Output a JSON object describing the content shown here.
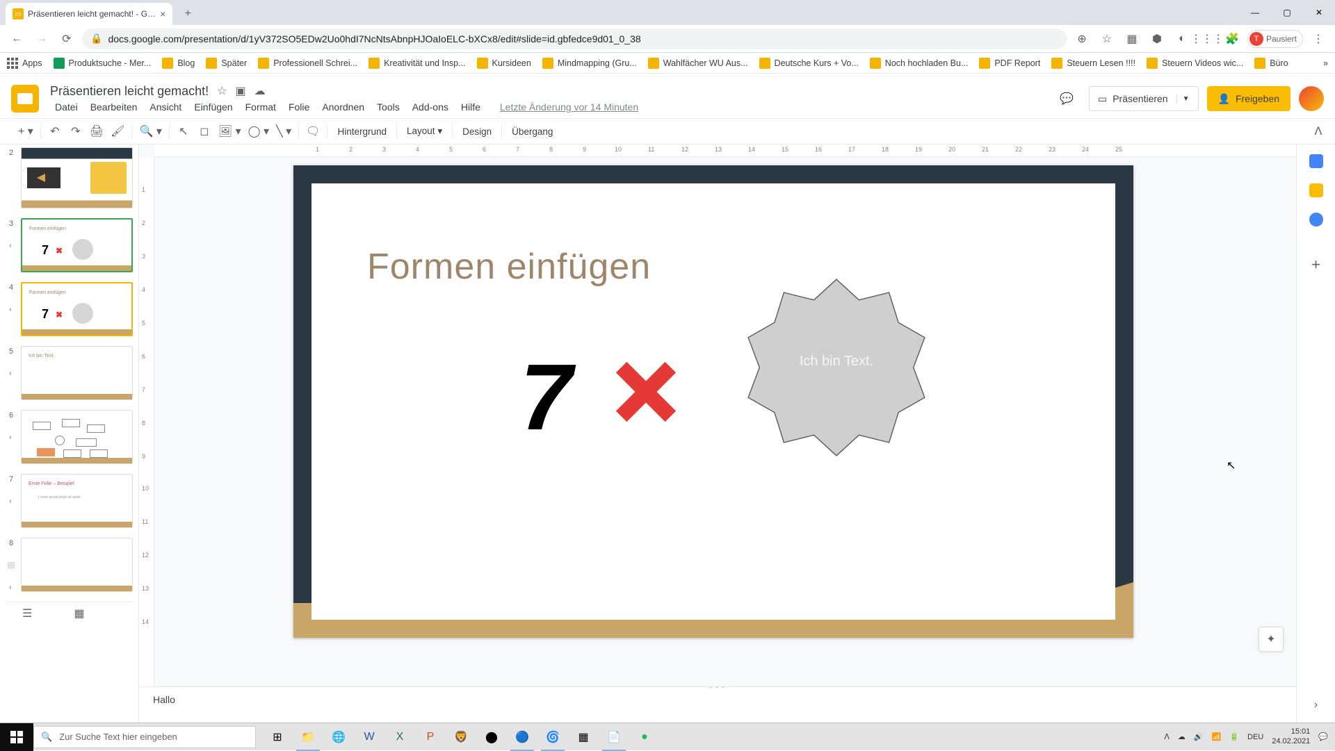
{
  "browser": {
    "tab_title": "Präsentieren leicht gemacht! - G…",
    "url": "docs.google.com/presentation/d/1yV372SO5EDw2Uo0hdI7NcNtsAbnpHJOaIoELC-bXCx8/edit#slide=id.gbfedce9d01_0_38",
    "profile_status": "Pausiert",
    "profile_initial": "T"
  },
  "bookmarks": [
    "Apps",
    "Produktsuche - Mer...",
    "Blog",
    "Später",
    "Professionell Schrei...",
    "Kreativität und Insp...",
    "Kursideen",
    "Mindmapping  (Gru...",
    "Wahlfächer WU Aus...",
    "Deutsche Kurs + Vo...",
    "Noch hochladen Bu...",
    "PDF Report",
    "Steuern Lesen !!!!",
    "Steuern Videos wic...",
    "Büro"
  ],
  "doc": {
    "title": "Präsentieren leicht gemacht!",
    "menus": [
      "Datei",
      "Bearbeiten",
      "Ansicht",
      "Einfügen",
      "Format",
      "Folie",
      "Anordnen",
      "Tools",
      "Add-ons",
      "Hilfe"
    ],
    "last_edit": "Letzte Änderung vor 14 Minuten",
    "present": "Präsentieren",
    "share": "Freigeben"
  },
  "toolbar": {
    "background": "Hintergrund",
    "layout": "Layout",
    "design": "Design",
    "transition": "Übergang"
  },
  "ruler_h": [
    "1",
    "2",
    "3",
    "4",
    "5",
    "6",
    "7",
    "8",
    "9",
    "10",
    "11",
    "12",
    "13",
    "14",
    "15",
    "16",
    "17",
    "18",
    "19",
    "20",
    "21",
    "22",
    "23",
    "24",
    "25"
  ],
  "ruler_v": [
    "1",
    "2",
    "3",
    "4",
    "5",
    "6",
    "7",
    "8",
    "9",
    "10",
    "11",
    "12",
    "13",
    "14"
  ],
  "slide": {
    "title": "Formen einfügen",
    "big_number": "7",
    "shape_text": "Ich bin Text."
  },
  "thumbnails": {
    "nums": [
      "2",
      "3",
      "4",
      "5",
      "6",
      "7",
      "8"
    ],
    "mini_title_34": "Formen einfügen",
    "mini_title_5": "Ich bin Text.",
    "mini_title_7": "Erste Folie – Beispiel"
  },
  "speaker_notes": "Hallo",
  "taskbar": {
    "search_placeholder": "Zur Suche Text hier eingeben",
    "lang": "DEU",
    "time": "15:01",
    "date": "24.02.2021"
  }
}
